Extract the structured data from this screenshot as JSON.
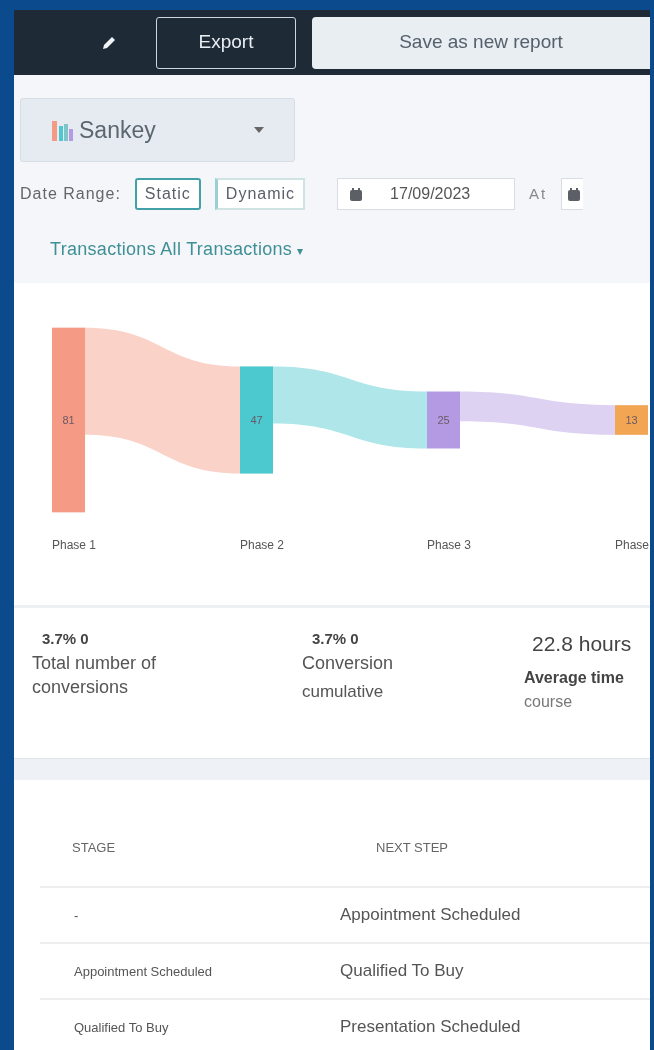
{
  "toolbar": {
    "buttons": [
      {
        "label": "Export",
        "kind": "outline"
      },
      {
        "label": "Save as new report",
        "kind": "light"
      }
    ]
  },
  "chart_type": {
    "label": "Sankey"
  },
  "date_range": {
    "label": "Date Range:",
    "modes": [
      {
        "label": "Static",
        "selected": true
      },
      {
        "label": "Dynamic",
        "selected": false
      }
    ],
    "start_date": "17/09/2023",
    "at_label": "At"
  },
  "filter": {
    "label": "Transactions All Transactions",
    "caret": "▾"
  },
  "sankey": {
    "nodes": [
      {
        "value": "81",
        "phase": "Phase 1",
        "color": "#f59a84"
      },
      {
        "value": "47",
        "phase": "Phase 2",
        "color": "#4cc8cf"
      },
      {
        "value": "25",
        "phase": "Phase 3",
        "color": "#b49ae3"
      },
      {
        "value": "13",
        "phase": "Phase",
        "color": "#f2a654"
      }
    ]
  },
  "stats": [
    {
      "kind": "percent",
      "value": "3.7% 0",
      "label": "Total number of conversions"
    },
    {
      "kind": "percent",
      "value": "3.7% 0",
      "label": "Conversion",
      "sub": "cumulative"
    },
    {
      "kind": "duration",
      "value": "22.8 hours",
      "label": "Average time",
      "sub": "course"
    }
  ],
  "table": {
    "columns": [
      "STAGE",
      "NEXT STEP"
    ],
    "rows": [
      [
        "-",
        "Appointment Scheduled"
      ],
      [
        "Appointment Scheduled",
        "Qualified To Buy"
      ],
      [
        "Qualified To Buy",
        "Presentation Scheduled"
      ]
    ]
  }
}
